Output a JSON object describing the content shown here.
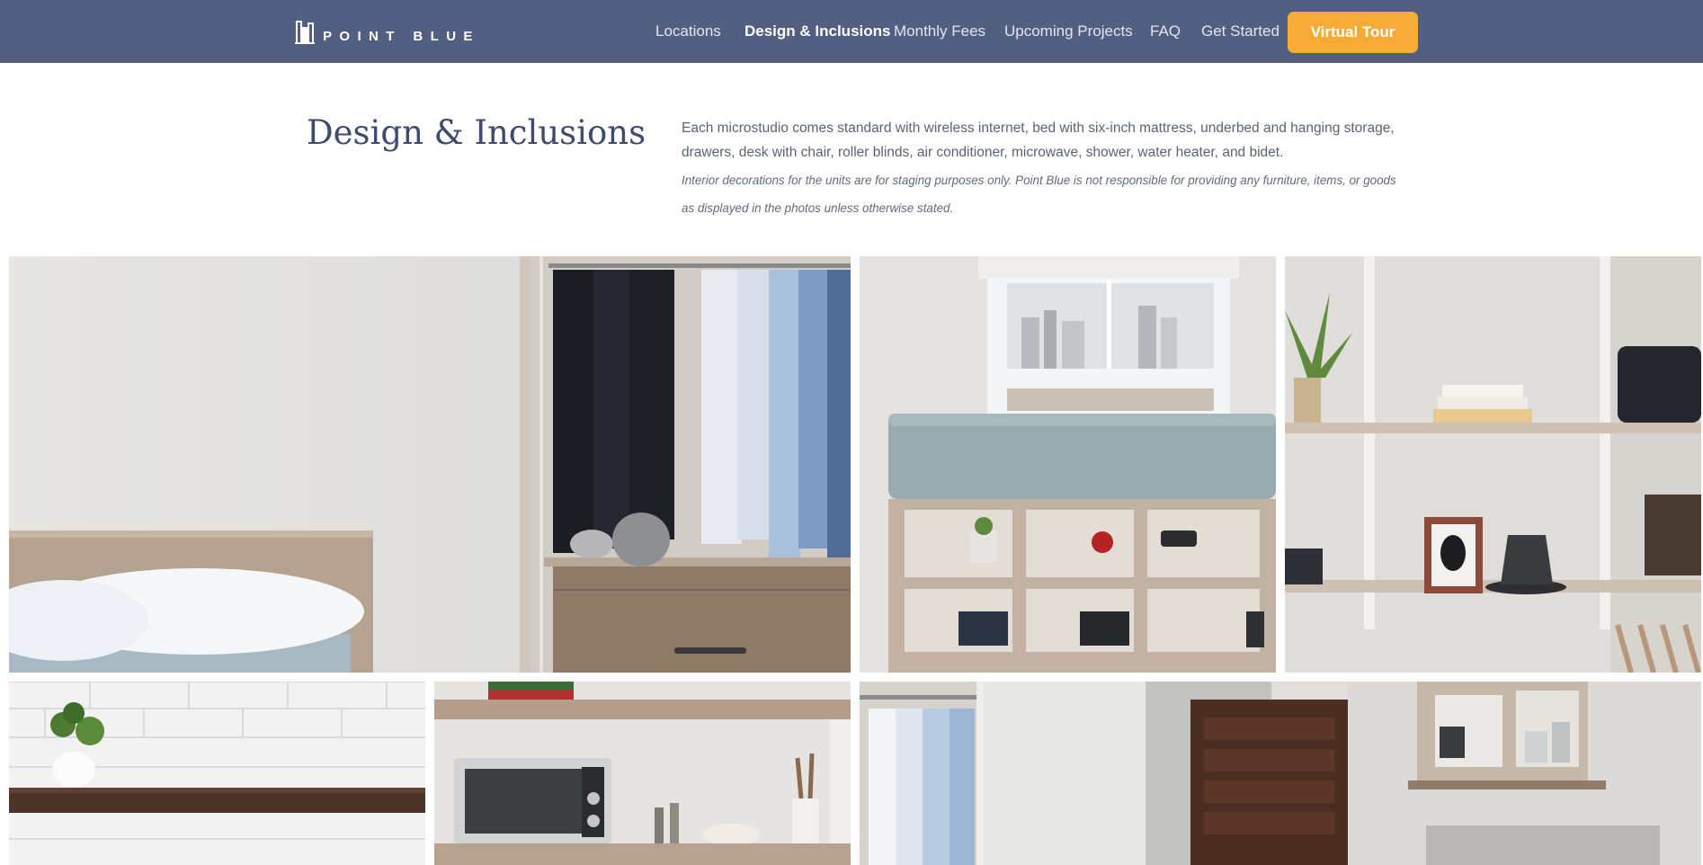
{
  "header": {
    "brand": "POINTBLUE",
    "brand_display": "POINT BLUE",
    "nav": [
      {
        "label": "Locations",
        "active": false
      },
      {
        "label": "Design & Inclusions",
        "active": true
      },
      {
        "label": "Monthly Fees",
        "active": false
      },
      {
        "label": "Upcoming Projects",
        "active": false
      },
      {
        "label": "FAQ",
        "active": false
      },
      {
        "label": "Get Started",
        "active": false
      }
    ],
    "cta_label": "Virtual Tour"
  },
  "intro": {
    "title": "Design & Inclusions",
    "text": "Each microstudio comes standard with wireless internet, bed with six-inch mattress, underbed and hanging storage, drawers, desk with chair, roller blinds, air conditioner, microwave, shower, water heater, and bidet.",
    "note": "Interior decorations for the units are for staging purposes only. Point Blue is not responsible for providing any furniture, items, or goods as displayed in the photos unless otherwise stated."
  },
  "gallery": {
    "photos": [
      {
        "subject": "bed-and-closet"
      },
      {
        "subject": "bed-with-underbed-storage"
      },
      {
        "subject": "open-shelving"
      },
      {
        "subject": "kitchen-shelf"
      },
      {
        "subject": "microwave-shelf"
      },
      {
        "subject": "closet-and-entry-door"
      }
    ]
  },
  "colors": {
    "header_bg": "#535f80",
    "cta_bg": "#f7ab34",
    "title": "#3f4b6d",
    "body_text": "#5b6373"
  }
}
